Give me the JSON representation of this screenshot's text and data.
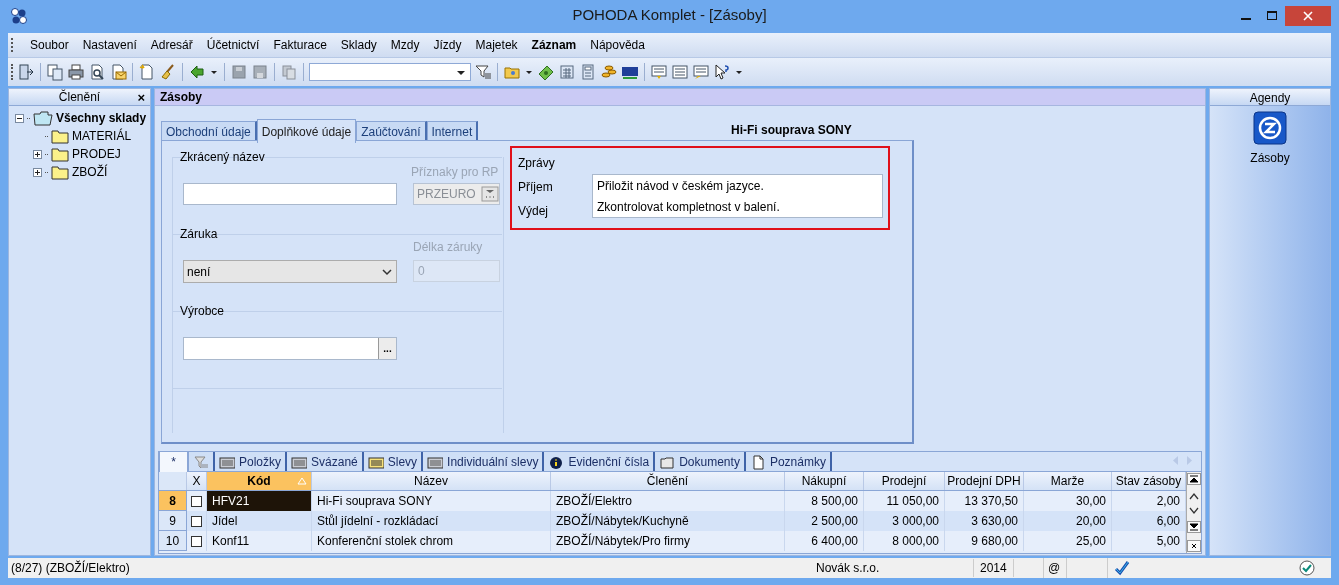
{
  "window": {
    "title": "POHODA Komplet - [Zásoby]"
  },
  "menu": [
    {
      "label": "Soubor",
      "bold": false
    },
    {
      "label": "Nastavení",
      "bold": false
    },
    {
      "label": "Adresář",
      "bold": false
    },
    {
      "label": "Účetnictví",
      "bold": false
    },
    {
      "label": "Fakturace",
      "bold": false
    },
    {
      "label": "Sklady",
      "bold": false
    },
    {
      "label": "Mzdy",
      "bold": false
    },
    {
      "label": "Jízdy",
      "bold": false
    },
    {
      "label": "Majetek",
      "bold": false
    },
    {
      "label": "Záznam",
      "bold": true
    },
    {
      "label": "Nápověda",
      "bold": false
    }
  ],
  "sidebar": {
    "title": "Členění",
    "close": "×",
    "tree": [
      {
        "label": "Všechny sklady",
        "expanded": true,
        "children": [
          {
            "label": "MATERIÁL"
          },
          {
            "label": "PRODEJ",
            "expanded": false
          },
          {
            "label": "ZBOŽÍ",
            "expanded": false
          }
        ]
      }
    ]
  },
  "agenda": {
    "title": "Zásoby",
    "record_title": "Hi-Fi souprava SONY",
    "tabs": [
      {
        "label": "Obchodní údaje",
        "selected": false
      },
      {
        "label": "Doplňkové údaje",
        "selected": true
      },
      {
        "label": "Zaúčtování",
        "selected": false
      },
      {
        "label": "Internet",
        "selected": false
      }
    ],
    "form": {
      "short_name": {
        "label": "Zkrácený název"
      },
      "flags": {
        "label": "Příznaky pro RP",
        "value": "PRZEURO",
        "disabled": true
      },
      "warranty": {
        "label": "Záruka",
        "value": "není"
      },
      "warranty_length": {
        "label": "Délka záruky",
        "value": "0",
        "disabled": true
      },
      "manufacturer": {
        "label": "Výrobce",
        "button": "..."
      },
      "messages": {
        "label": "Zprávy",
        "rows": [
          {
            "label": "Příjem",
            "value": "Přiložit návod v českém jazyce."
          },
          {
            "label": "Výdej",
            "value": "Zkontrolovat kompletnost v balení."
          }
        ]
      }
    },
    "bottom_tabs": [
      {
        "kind": "text",
        "label": "*",
        "selected": true
      },
      {
        "kind": "filter",
        "selected": false
      },
      {
        "kind": "list",
        "label": "Položky",
        "selected": false
      },
      {
        "kind": "list",
        "label": "Svázané",
        "selected": false
      },
      {
        "kind": "striped",
        "label": "Slevy",
        "selected": false
      },
      {
        "kind": "list",
        "label": "Individuální slevy",
        "selected": false
      },
      {
        "kind": "info",
        "label": "Evidenční čísla",
        "selected": false
      },
      {
        "kind": "folder",
        "label": "Dokumenty",
        "selected": false
      },
      {
        "kind": "page",
        "label": "Poznámky",
        "selected": false
      }
    ],
    "table": {
      "check_column": "X",
      "columns": [
        {
          "label": "Kód",
          "sorted": true
        },
        {
          "label": "Název",
          "sorted": false
        },
        {
          "label": "Členění",
          "sorted": false
        },
        {
          "label": "Nákupní",
          "sorted": false
        },
        {
          "label": "Prodejní",
          "sorted": false
        },
        {
          "label": "Prodejní DPH",
          "sorted": false
        },
        {
          "label": "Marže",
          "sorted": false
        },
        {
          "label": "Stav zásoby",
          "sorted": false
        }
      ],
      "rows": [
        {
          "number": "8",
          "checked": false,
          "selected": true,
          "cells": [
            "HFV21",
            "Hi-Fi souprava SONY",
            "ZBOŽÍ/Elektro",
            "8 500,00",
            "11 050,00",
            "13 370,50",
            "30,00",
            "2,00"
          ]
        },
        {
          "number": "9",
          "checked": false,
          "selected": false,
          "cells": [
            "Jídel",
            "Stůl jídelní - rozkládací",
            "ZBOŽÍ/Nábytek/Kuchyně",
            "2 500,00",
            "3 000,00",
            "3 630,00",
            "20,00",
            "6,00"
          ]
        },
        {
          "number": "10",
          "checked": false,
          "selected": false,
          "cells": [
            "Konf11",
            "Konferenční stolek chrom",
            "ZBOŽÍ/Nábytek/Pro firmy",
            "6 400,00",
            "8 000,00",
            "9 680,00",
            "25,00",
            "5,00"
          ]
        }
      ]
    }
  },
  "agendas": {
    "title": "Agendy",
    "items": [
      {
        "label": "Zásoby"
      }
    ]
  },
  "status_bar": {
    "position": "(8/27) (ZBOŽÍ/Elektro)",
    "company": "Novák s.r.o.",
    "year": "2014",
    "email": "@"
  }
}
